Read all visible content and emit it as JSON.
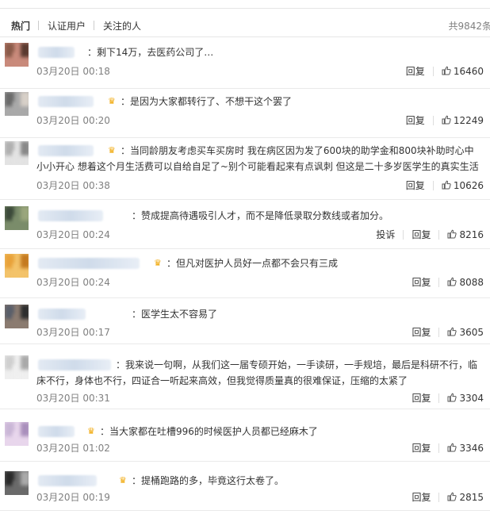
{
  "tabs": [
    {
      "label": "热门"
    },
    {
      "label": "认证用户"
    },
    {
      "label": "关注的人"
    }
  ],
  "total": "共9842条",
  "actions": {
    "reply": "回复",
    "report": "投诉"
  },
  "colors": {
    "crown": "#f0a500",
    "muted": "#808080",
    "text": "#333333"
  },
  "comments": [
    {
      "text": "：剩下14万，去医药公司了…",
      "time": "03月20日 00:18",
      "likes": "16460",
      "crown": false,
      "report": false
    },
    {
      "text": "：是因为大家都转行了、不想干这个罢了",
      "time": "03月20日 00:20",
      "likes": "12249",
      "crown": true,
      "report": false
    },
    {
      "text": "：当同龄朋友考虑买车买房时 我在病区因为发了600块的助学金和800块补助时心中小小开心 想着这个月生活费可以自给自足了~别个可能看起来有点讽刺 但这是二十多岁医学生的真实生活",
      "time": "03月20日 00:38",
      "likes": "10626",
      "crown": true,
      "report": false
    },
    {
      "text": "：赞成提高待遇吸引人才，而不是降低录取分数线或者加分。",
      "time": "03月20日 00:24",
      "likes": "8216",
      "crown": false,
      "report": true
    },
    {
      "text": "：但凡对医护人员好一点都不会只有三成",
      "time": "03月20日 00:24",
      "likes": "8088",
      "crown": true,
      "report": false
    },
    {
      "text": "：医学生太不容易了",
      "time": "03月20日 00:17",
      "likes": "3605",
      "crown": false,
      "report": false
    },
    {
      "text": "：我来说一句啊，从我们这一届专硕开始，一手读研，一手规培，最后是科研不行，临床不行，身体也不行，四证合一听起来高效，但我觉得质量真的很难保证，压缩的太紧了",
      "time": "03月20日 00:31",
      "likes": "3304",
      "crown": false,
      "report": false
    },
    {
      "text": "：当大家都在吐槽996的时候医护人员都已经麻木了",
      "time": "03月20日 01:02",
      "likes": "3346",
      "crown": true,
      "report": false
    },
    {
      "text": "：提桶跑路的多，毕竟这行太卷了。",
      "time": "03月20日 00:19",
      "likes": "2815",
      "crown": true,
      "report": false
    }
  ]
}
